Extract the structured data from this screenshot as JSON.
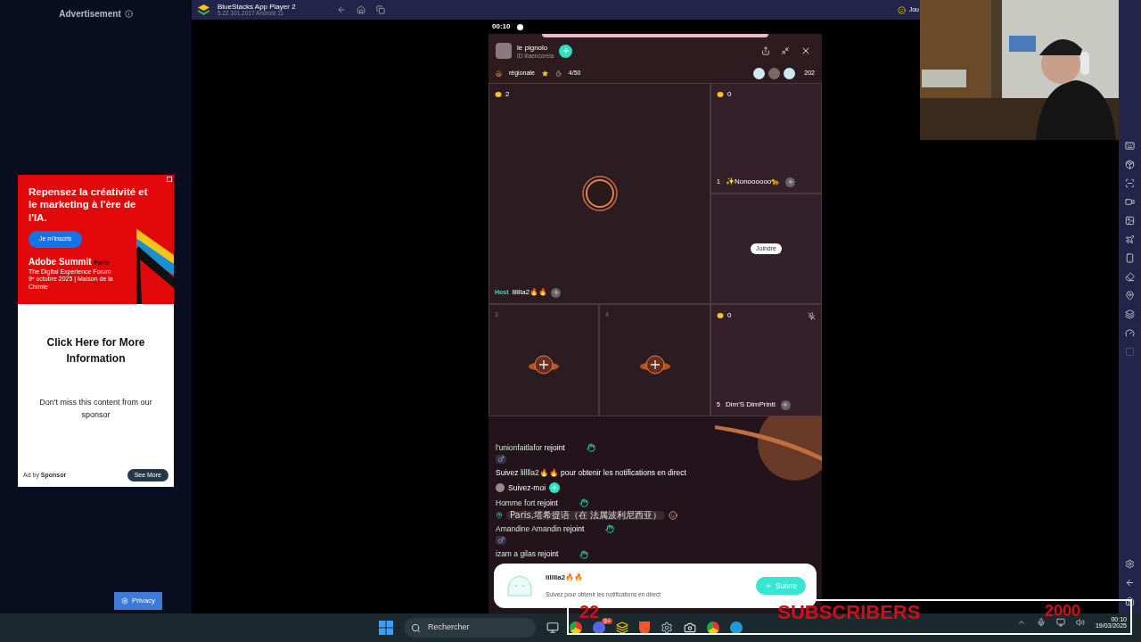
{
  "ad_panel": {
    "heading": "Advertisement",
    "ad": {
      "headline": "Repensez la créativité et le marketing à l'ère de l'IA.",
      "cta": "Je m'inscris",
      "brand": "Adobe Summit",
      "brand_city": "Paris",
      "tagline": "The Digital Experience Forum",
      "date_line": "9ᵉ octobre 2025 | Maison de la Chimie",
      "title": "Click Here for More Information",
      "body": "Don't miss this content from our sponsor",
      "ad_by": "Ad by",
      "sponsor": "Sponsor",
      "button": "See More"
    },
    "privacy_button": "Privacy"
  },
  "emulator": {
    "title": "BlueStacks App Player 2",
    "version": "5.22.101.2017  Android 11",
    "corner_label": "Jou"
  },
  "phone": {
    "status_time": "00:10",
    "room": {
      "host_name": "le pignolo",
      "host_id": "ID lilaencorela",
      "tag": "régionale",
      "level": "4/50",
      "viewer_count": "202"
    },
    "seats": [
      {
        "kind": "host",
        "coins": "2",
        "badge": "Host",
        "name": "lilllla2🔥🔥",
        "muted": false
      },
      {
        "kind": "occupied",
        "number": "1",
        "coins": "0",
        "name": "✨Nonoooooo🐆",
        "muted": false
      },
      {
        "kind": "join",
        "button": "Joindre"
      },
      {
        "kind": "empty",
        "number": "3"
      },
      {
        "kind": "empty",
        "number": "4"
      },
      {
        "kind": "occupied",
        "number": "5",
        "coins": "0",
        "name": "Dim'S DimPrinti",
        "muted": true
      }
    ],
    "chat": [
      {
        "kind": "join",
        "name": "l'unionfaitlafor",
        "verb": "rejoint",
        "male": true
      },
      {
        "kind": "prompt",
        "prefix": "Suivez",
        "name": "lilllla2🔥🔥",
        "suffix": "pour obtenir les notifications en direct"
      },
      {
        "kind": "follow_me",
        "text": "Suivez-moi"
      },
      {
        "kind": "join",
        "name": "Homme fort",
        "verb": "rejoint",
        "male": false,
        "location": "Paris,塔希提语（在 法属波利尼西亚）"
      },
      {
        "kind": "join",
        "name": "Amandine Amandin",
        "verb": "rejoint",
        "male": true
      },
      {
        "kind": "join",
        "name": "izam a gilas",
        "verb": "rejoint",
        "male": false
      }
    ],
    "follow_card": {
      "name": "lilllla2🔥🔥",
      "text": "Suivez pour obtenir les notifications en direct",
      "button": "Suivre"
    }
  },
  "taskbar": {
    "search_placeholder": "Rechercher",
    "chat_badge": "9+",
    "time": "00:10",
    "date": "19/03/2025"
  },
  "overlay": {
    "left_count": "22",
    "label": "SUBSCRIBERS",
    "goal": "2000"
  }
}
